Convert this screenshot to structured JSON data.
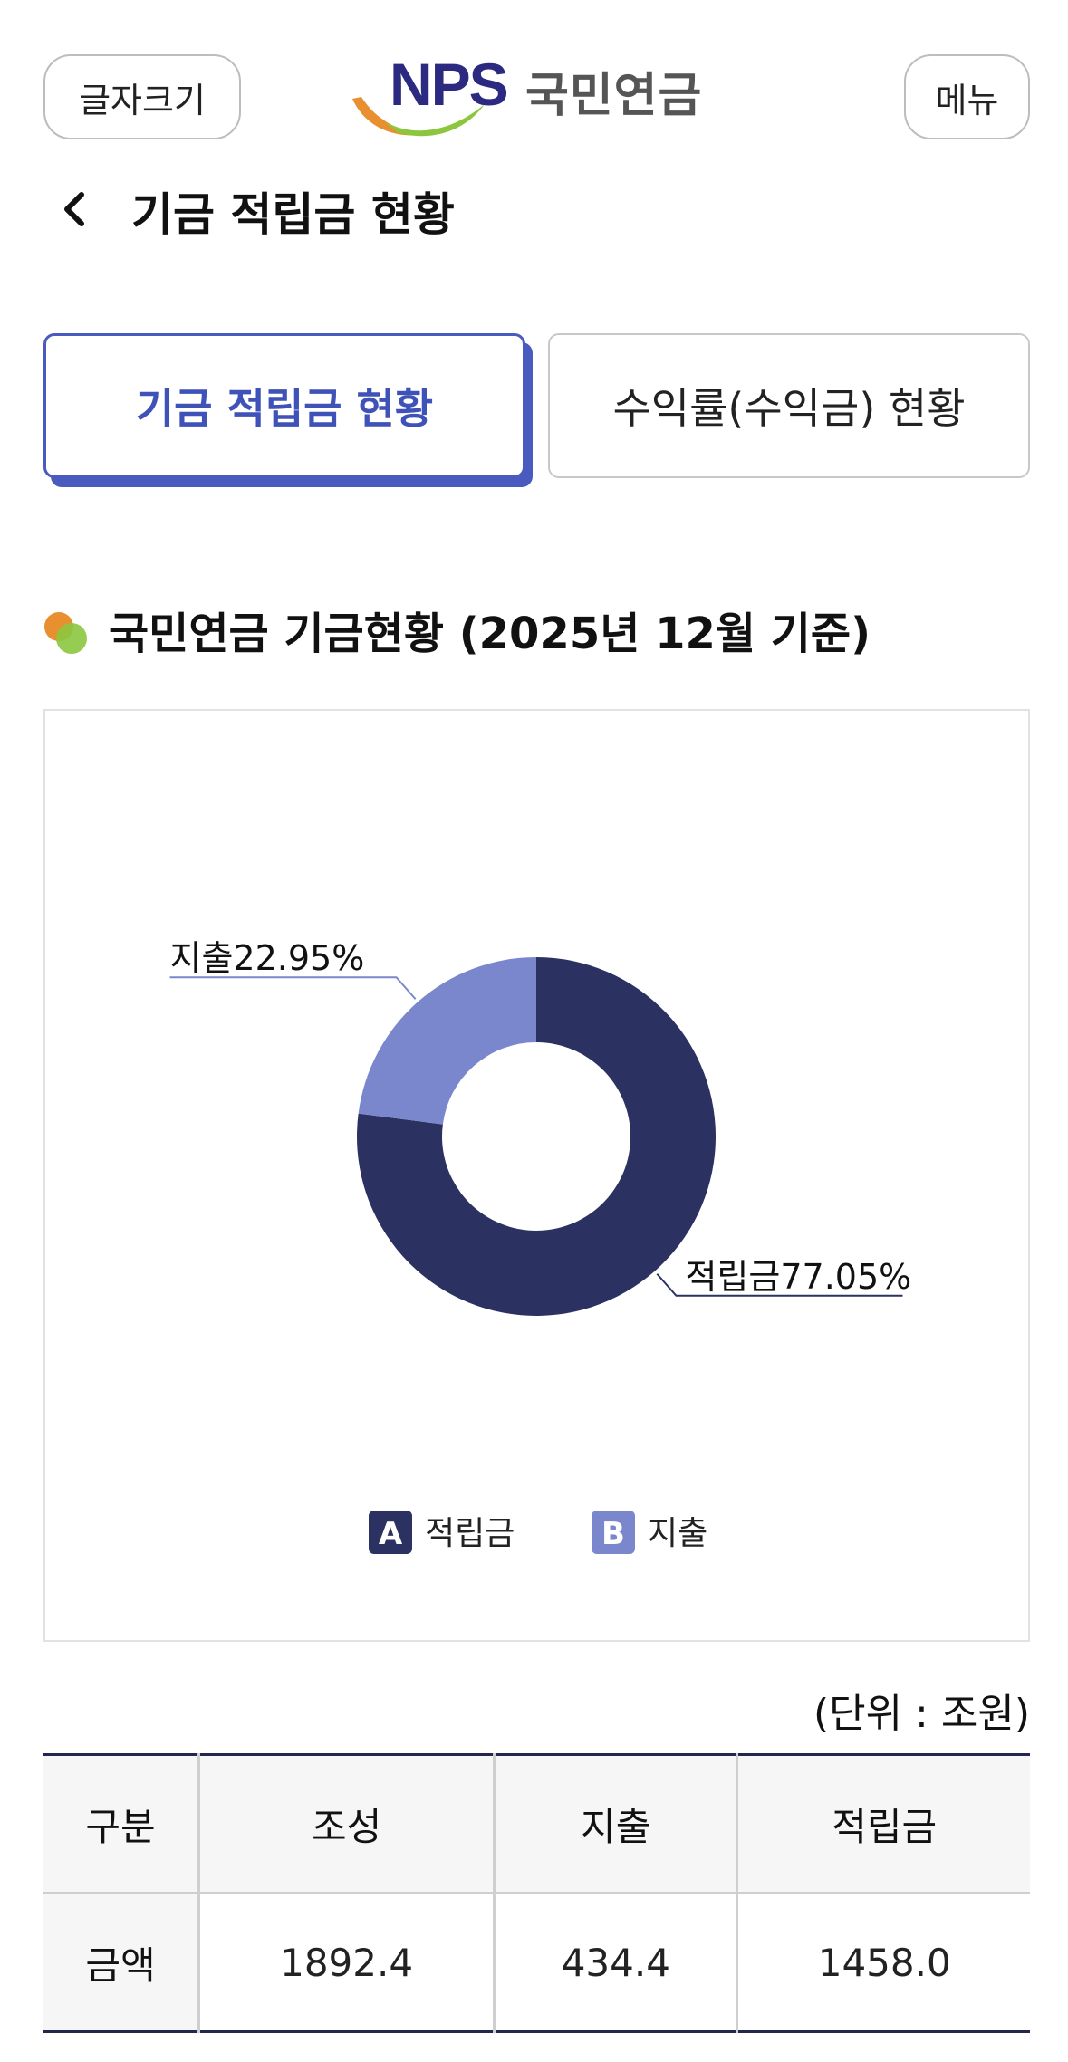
{
  "header": {
    "font_size_label": "글자크기",
    "logo_word": "NPS",
    "logo_korean": "국민연금",
    "menu_label": "메뉴"
  },
  "page": {
    "title": "기금 적립금 현황"
  },
  "tabs": [
    {
      "label": "기금 적립금 현황",
      "active": true
    },
    {
      "label": "수익률(수익금) 현황",
      "active": false
    }
  ],
  "section": {
    "title": "국민연금 기금현황 (2025년 12월 기준)"
  },
  "colors": {
    "reserve": "#2b3160",
    "expense": "#7a87cc",
    "accent": "#3f52b8"
  },
  "chart_data": {
    "type": "pie",
    "donut": true,
    "slices": [
      {
        "name": "적립금",
        "value": 77.05,
        "data_label": "적립금77.05%",
        "legend_badge": "A",
        "color": "#2b3160"
      },
      {
        "name": "지출",
        "value": 22.95,
        "data_label": "지출22.95%",
        "legend_badge": "B",
        "color": "#7a87cc"
      }
    ],
    "legend_placement": "bottom-center"
  },
  "table": {
    "unit": "(단위 : 조원)",
    "headers": [
      "구분",
      "조성",
      "지출",
      "적립금"
    ],
    "rows": [
      [
        "금액",
        "1892.4",
        "434.4",
        "1458.0"
      ]
    ]
  }
}
